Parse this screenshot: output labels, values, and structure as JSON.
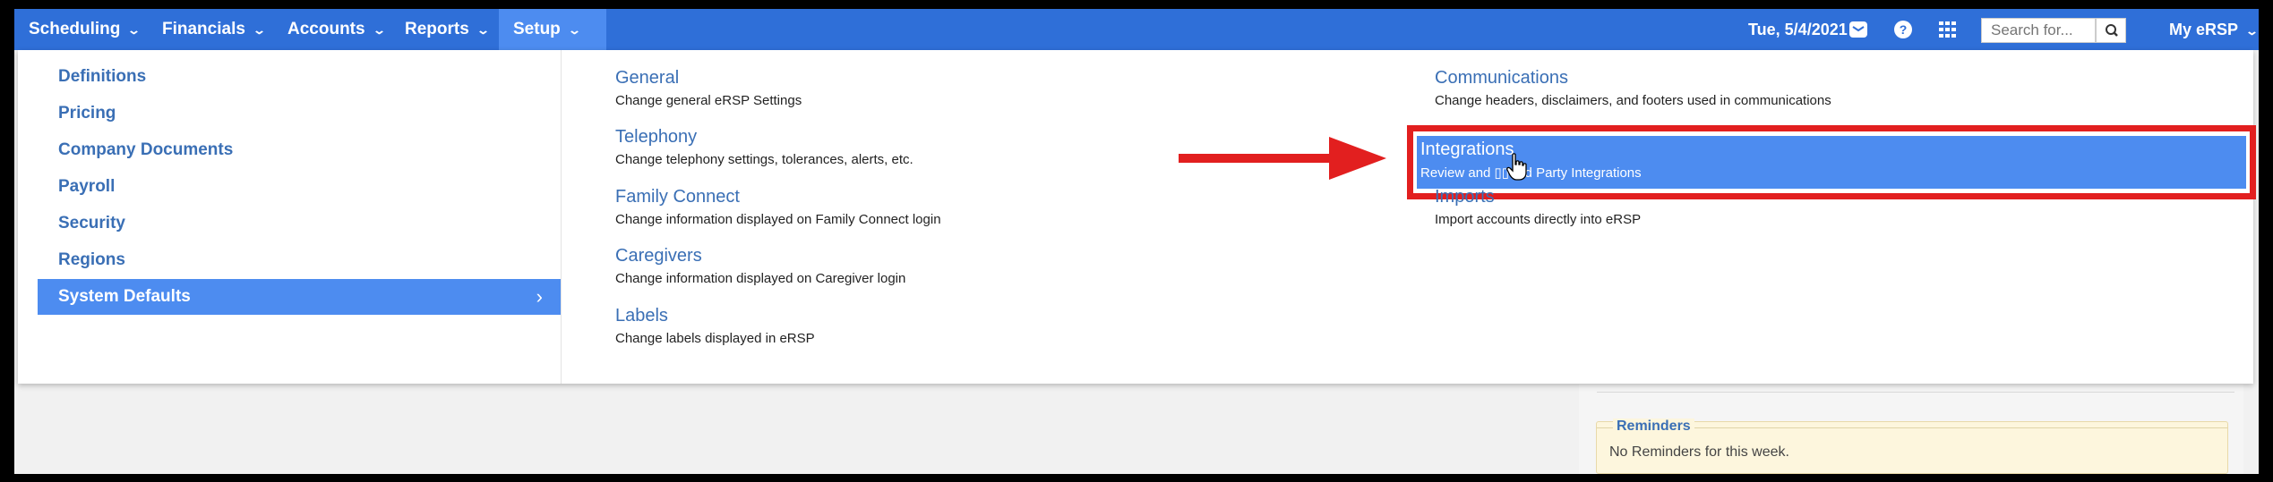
{
  "colors": {
    "nav_bg": "#2f6fd8",
    "highlight": "#4d8cf0",
    "link_blue": "#3a6fb5",
    "annotation_red": "#e21f1f",
    "reminder_bg": "#fdf6dd"
  },
  "nav": {
    "items": [
      {
        "label": "Scheduling",
        "icon": "chevron-down-icon"
      },
      {
        "label": "Financials",
        "icon": "chevron-down-icon"
      },
      {
        "label": "Accounts",
        "icon": "chevron-down-icon"
      },
      {
        "label": "Reports",
        "icon": "chevron-down-icon"
      },
      {
        "label": "Setup",
        "icon": "chevron-down-icon",
        "active": true
      }
    ],
    "date": "Tue, 5/4/2021",
    "icons": [
      "envelope-icon",
      "help-icon",
      "apps-grid-icon"
    ],
    "search_placeholder": "Search for...",
    "search_icon": "search-icon",
    "user_menu": "My eRSP"
  },
  "menu": {
    "left_items": [
      {
        "label": "Definitions"
      },
      {
        "label": "Pricing"
      },
      {
        "label": "Company Documents"
      },
      {
        "label": "Payroll"
      },
      {
        "label": "Security"
      },
      {
        "label": "Regions"
      },
      {
        "label": "System Defaults",
        "selected": true,
        "icon": "chevron-right-icon"
      }
    ],
    "column1": [
      {
        "title": "General",
        "desc": "Change general eRSP Settings"
      },
      {
        "title": "Telephony",
        "desc": "Change telephony settings, tolerances, alerts, etc."
      },
      {
        "title": "Family Connect",
        "desc": "Change information displayed on Family Connect login"
      },
      {
        "title": "Caregivers",
        "desc": "Change information displayed on Caregiver login"
      },
      {
        "title": "Labels",
        "desc": "Change labels displayed in eRSP"
      }
    ],
    "column2": [
      {
        "title": "Communications",
        "desc": "Change headers, disclaimers, and footers used in communications"
      },
      {
        "title": "Integrations",
        "desc": "Review and ▯▯ 3rd Party Integrations",
        "highlighted": true
      },
      {
        "title": "Imports",
        "desc": "Import accounts directly into eRSP"
      }
    ]
  },
  "reminders": {
    "title": "Reminders",
    "text": "No Reminders for this week."
  },
  "annotations": {
    "arrow": "red-arrow-icon",
    "cursor": "hand-pointer-icon"
  }
}
